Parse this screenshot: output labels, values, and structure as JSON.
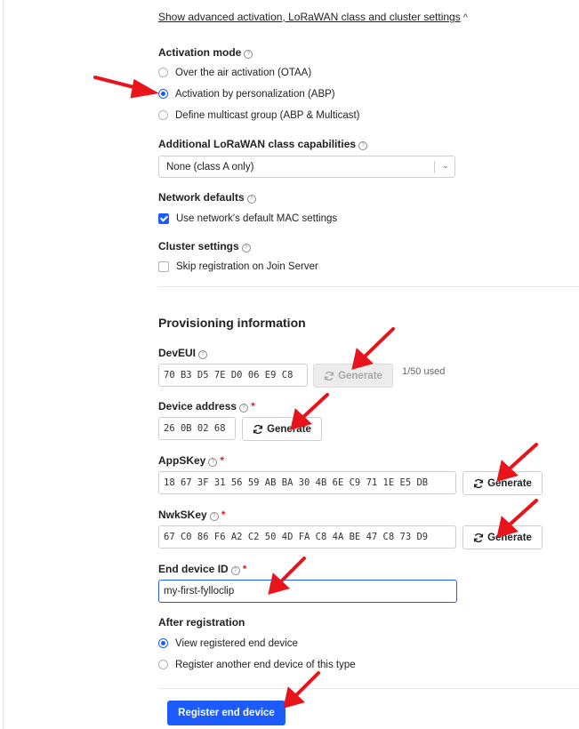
{
  "advanced": {
    "link_label": "Show advanced activation, LoRaWAN class and cluster settings",
    "toggle_glyph": "^"
  },
  "activation": {
    "label": "Activation mode",
    "options": [
      "Over the air activation (OTAA)",
      "Activation by personalization (ABP)",
      "Define multicast group (ABP & Multicast)"
    ],
    "selected_index": 1
  },
  "lorawan_class": {
    "label": "Additional LoRaWAN class capabilities",
    "value": "None (class A only)"
  },
  "network_defaults": {
    "label": "Network defaults",
    "checkbox_label": "Use network's default MAC settings",
    "checked": true
  },
  "cluster": {
    "label": "Cluster settings",
    "checkbox_label": "Skip registration on Join Server",
    "checked": false
  },
  "provisioning": {
    "title": "Provisioning information",
    "dev_eui": {
      "label": "DevEUI",
      "value": "70 B3 D5 7E D0 06 E9 C8",
      "button": "Generate",
      "usage": "1/50 used"
    },
    "device_address": {
      "label": "Device address",
      "required": "*",
      "value": "26 0B 02 68",
      "button": "Generate"
    },
    "app_skey": {
      "label": "AppSKey",
      "required": "*",
      "value": "18 67 3F 31 56 59 AB BA 30 4B 6E C9 71 1E E5 DB",
      "button": "Generate"
    },
    "nwk_skey": {
      "label": "NwkSKey",
      "required": "*",
      "value": "67 C0 86 F6 A2 C2 50 4D FA C8 4A BE 47 C8 73 D9",
      "button": "Generate"
    },
    "end_device_id": {
      "label": "End device ID",
      "required": "*",
      "value": "my-first-fylloclip"
    }
  },
  "after_registration": {
    "label": "After registration",
    "options": [
      "View registered end device",
      "Register another end device of this type"
    ],
    "selected_index": 0
  },
  "submit": {
    "label": "Register end device"
  },
  "colors": {
    "accent": "#1c5cff",
    "required": "#e0222b",
    "annotation_arrow": "#e8141b"
  },
  "icons": {
    "help": "help-circle-icon",
    "refresh": "refresh-icon",
    "dropdown": "chevron-down-icon"
  }
}
